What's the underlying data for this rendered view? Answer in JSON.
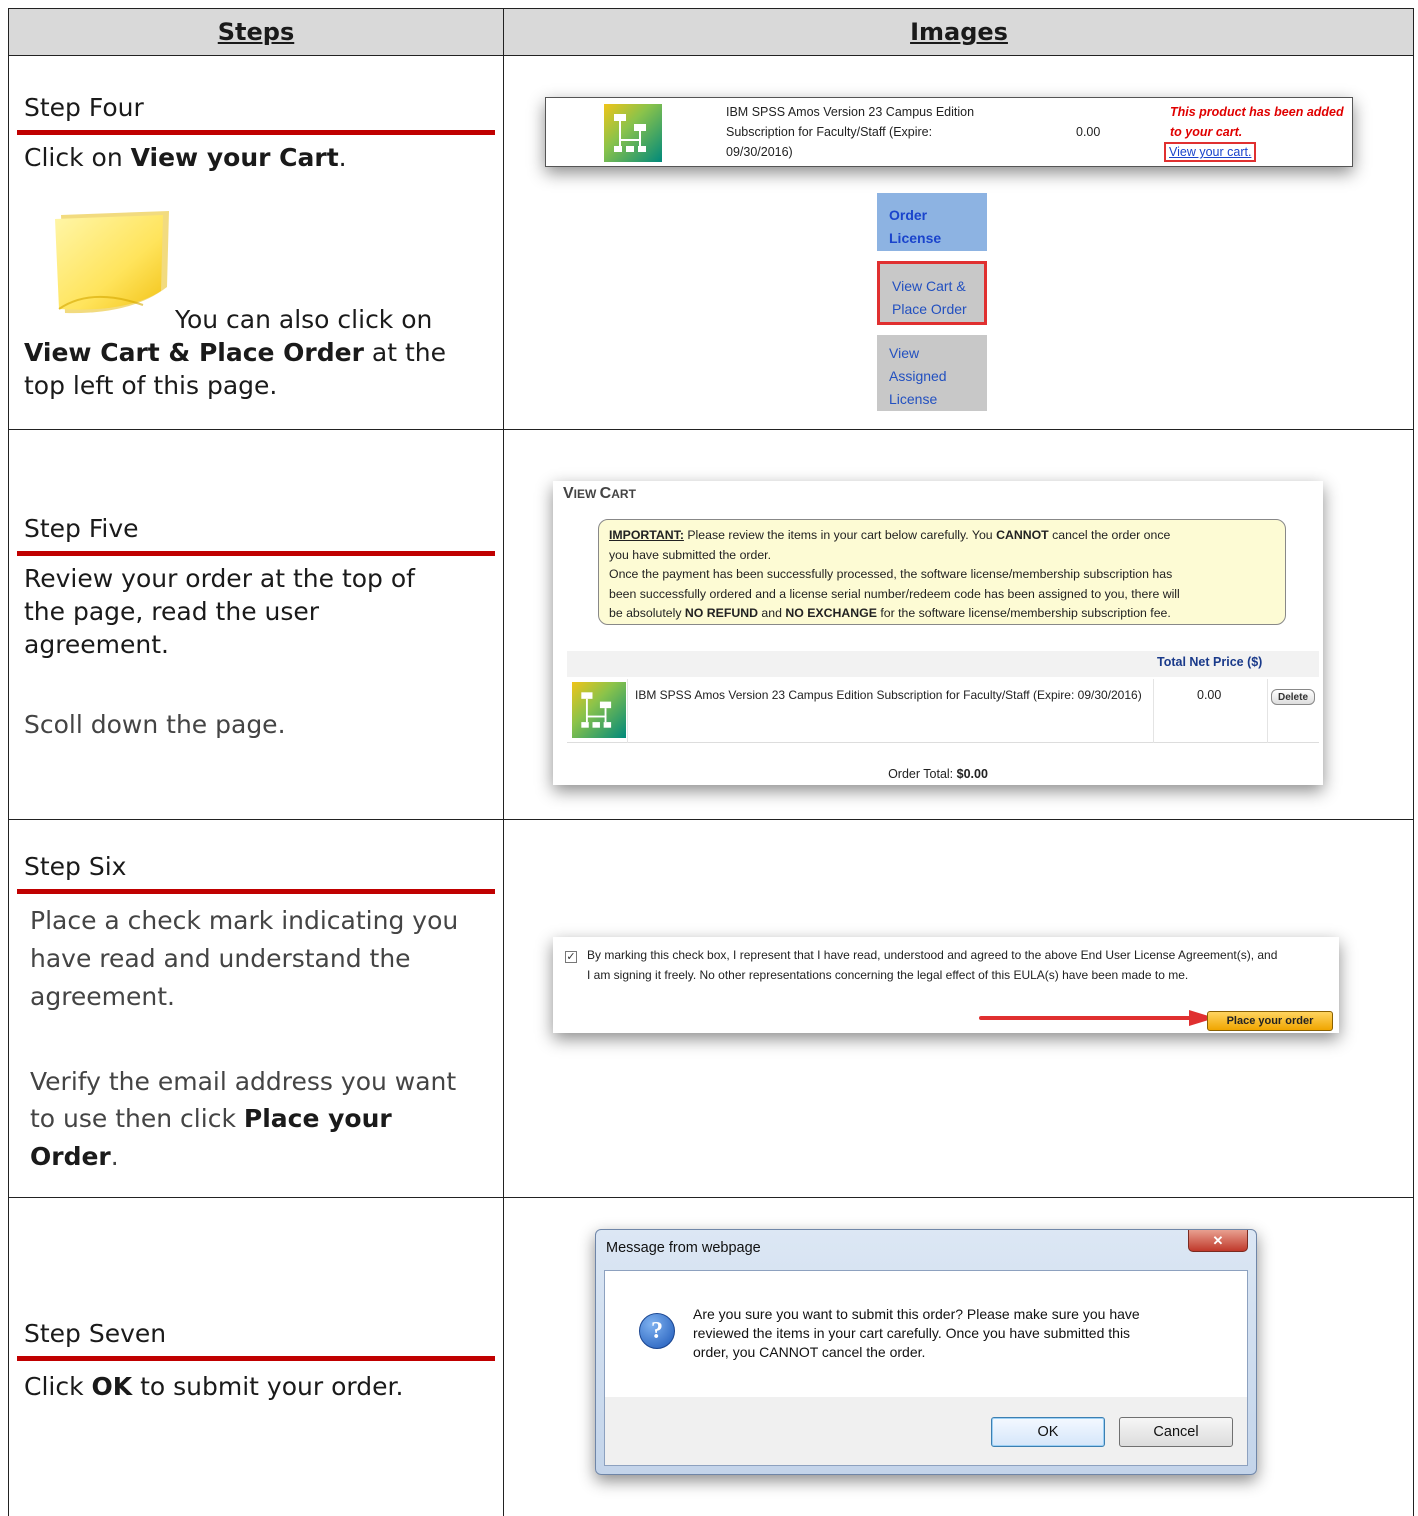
{
  "headers": {
    "steps": "Steps",
    "images": "Images"
  },
  "step4": {
    "title": "Step Four",
    "text_prefix": "Click on ",
    "text_bold": "View your Cart",
    "text_suffix": ".",
    "note_text": "You can also click on",
    "note_bold": "View Cart & Place Order",
    "note_suffix": " at the",
    "note_line3": "top left of this page.",
    "shot": {
      "product_line1": "IBM SPSS Amos Version 23 Campus Edition",
      "product_line2": "Subscription for Faculty/Staff (Expire:",
      "product_line3": "09/30/2016)",
      "price": "0.00",
      "added_line1": "This product has been added",
      "added_line2": "to your cart.",
      "view_cart_link": "View your cart.",
      "nav_order_1": "Order",
      "nav_order_2": "License",
      "nav_cart_1": "View Cart &",
      "nav_cart_2": "Place Order",
      "nav_assigned_1": "View",
      "nav_assigned_2": "Assigned",
      "nav_assigned_3": "License"
    }
  },
  "step5": {
    "title": "Step Five",
    "text_line1": "Review your order at the top of",
    "text_line2": "the page, read the user",
    "text_line3": "agreement.",
    "text_scroll": "Scoll down the page.",
    "shot": {
      "heading_v": "V",
      "heading_iew": "IEW ",
      "heading_c": "C",
      "heading_art": "ART",
      "important_label": "IMPORTANT:",
      "important_l1a": " Please review the items in your cart below carefully. You ",
      "important_cannot": "CANNOT",
      "important_l1b": " cancel the order once",
      "important_l2": "you have submitted the order.",
      "important_l3": "Once the payment has been successfully processed, the software license/membership subscription has",
      "important_l4": "been successfully ordered and a license serial number/redeem code has been assigned to you, there will",
      "important_l5a": "be absolutely ",
      "important_norefund": "NO REFUND",
      "important_and": " and ",
      "important_noexchange": "NO EXCHANGE",
      "important_l5b": " for the software license/membership subscription fee.",
      "col_total": "Total Net Price ($)",
      "item_desc": "IBM SPSS Amos Version 23 Campus Edition Subscription for Faculty/Staff (Expire: 09/30/2016)",
      "item_price": "0.00",
      "delete_label": "Delete",
      "order_total_label": "Order Total: ",
      "order_total_value": "$0.00"
    }
  },
  "step6": {
    "title": "Step Six",
    "text_line1": "Place a check mark indicating you",
    "text_line2": "have read and understand the",
    "text_line3": "agreement.",
    "verify_line1": "Verify the email address you want",
    "verify_line2_prefix": "to use then click ",
    "verify_bold1": "Place your",
    "verify_bold2": "Order",
    "verify_suffix": ".",
    "shot": {
      "eula_line1": "By marking this check box, I represent that I have read, understood and agreed to the above End User License Agreement(s), and",
      "eula_line2": "I am signing it freely. No other representations concerning the legal effect of this EULA(s) have been made to me.",
      "place_order_btn": "Place your order",
      "checkbox_checked": true
    }
  },
  "step7": {
    "title": "Step Seven",
    "text_prefix": "Click ",
    "text_bold": "OK",
    "text_suffix": " to submit your order.",
    "dialog": {
      "title": "Message from webpage",
      "close_glyph": "✕",
      "msg_line1": "Are you sure you want to submit this order? Please make sure you have",
      "msg_line2": "reviewed the items in your cart carefully. Once you have submitted this",
      "msg_line3": "order, you CANNOT cancel the order.",
      "ok_label": "OK",
      "cancel_label": "Cancel",
      "question_glyph": "?"
    }
  }
}
